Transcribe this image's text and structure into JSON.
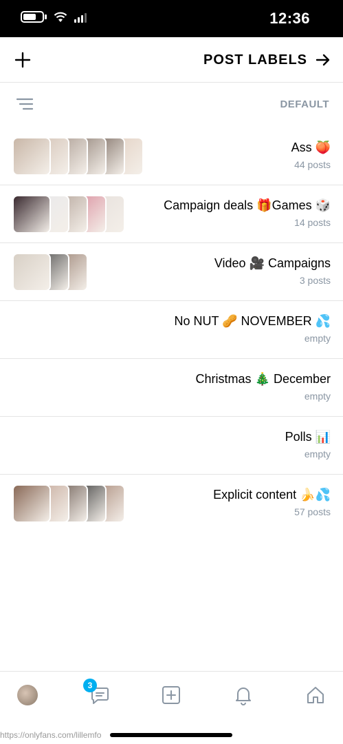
{
  "status_bar": {
    "time": "12:36"
  },
  "header": {
    "title": "POST LABELS"
  },
  "sort": {
    "label": "DEFAULT"
  },
  "labels": [
    {
      "title": "Ass 🍑",
      "count": "44 posts",
      "thumbs": [
        "#c9b7a8",
        "#d3c2b5",
        "#a99a90",
        "#8f8076",
        "#7a6a60",
        "#e2d0c2"
      ]
    },
    {
      "title": "Campaign deals 🎁Games 🎲",
      "count": "14 posts",
      "thumbs": [
        "#3a2a30",
        "#e8e8ea",
        "#b4a49a",
        "#d98c9c",
        "#e6e0dc"
      ]
    },
    {
      "title": "Video 🎥 Campaigns",
      "count": "3 posts",
      "thumbs": [
        "#d8d0c6",
        "#4a4a4a",
        "#9a8274"
      ]
    },
    {
      "title": "No NUT 🥜 NOVEMBER 💦",
      "count": "empty",
      "thumbs": []
    },
    {
      "title": "Christmas 🎄 December",
      "count": "empty",
      "thumbs": []
    },
    {
      "title": "Polls 📊",
      "count": "empty",
      "thumbs": []
    },
    {
      "title": "Explicit content 🍌💦",
      "count": "57 posts",
      "thumbs": [
        "#8a6a58",
        "#c4a89a",
        "#6a5a52",
        "#3a3a3a",
        "#a88878"
      ]
    }
  ],
  "bottom_nav": {
    "items": [
      {
        "name": "profile",
        "icon": "avatar-icon"
      },
      {
        "name": "messages",
        "icon": "message-icon",
        "badge": "3"
      },
      {
        "name": "new-post",
        "icon": "add-square-icon"
      },
      {
        "name": "notifications",
        "icon": "bell-icon"
      },
      {
        "name": "home",
        "icon": "home-icon"
      }
    ]
  },
  "url": "https://onlyfans.com/lillemfo"
}
